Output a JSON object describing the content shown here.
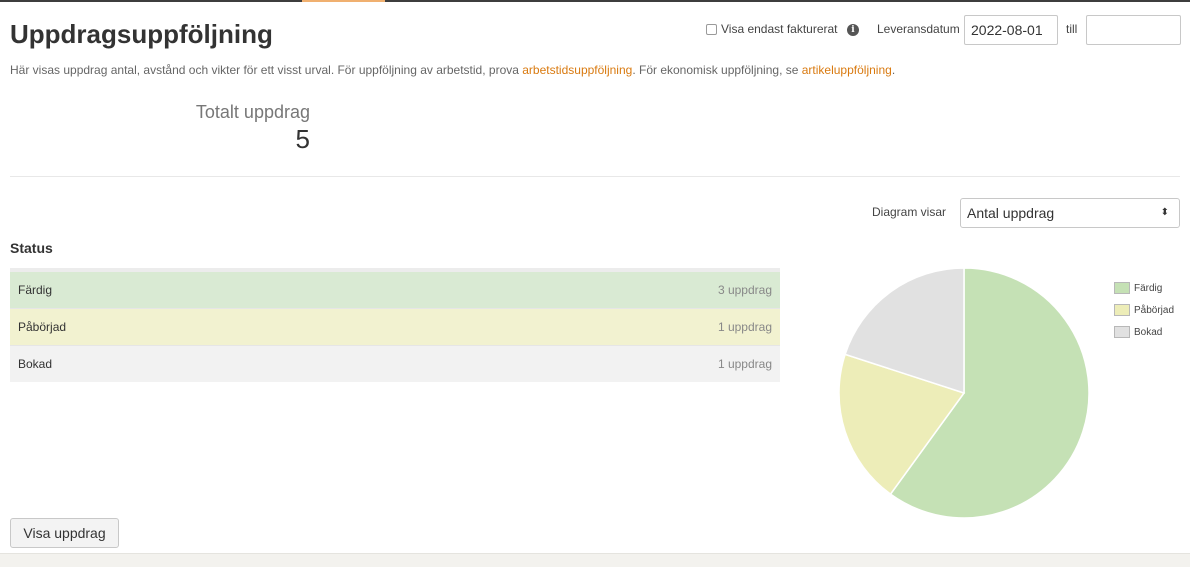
{
  "header": {
    "title": "Uppdragsuppföljning"
  },
  "filters": {
    "invoiced_only_label": "Visa endast fakturerat",
    "invoiced_only_checked": false,
    "info_icon": "info-icon",
    "delivery_date_label": "Leveransdatum",
    "date_from": "2022-08-01",
    "till_label": "till",
    "date_to": ""
  },
  "description": {
    "part1": "Här visas uppdrag antal, avstånd och vikter för ett visst urval. För uppföljning av arbetstid, prova ",
    "link1": "arbetstidsuppföljning",
    "part2": ". För ekonomisk uppföljning, se ",
    "link2": "artikeluppföljning",
    "part3": "."
  },
  "summary": {
    "total_label": "Totalt uppdrag",
    "total_value": "5"
  },
  "diagram": {
    "label": "Diagram visar",
    "selected": "Antal uppdrag"
  },
  "status": {
    "heading": "Status",
    "rows": [
      {
        "label": "Färdig",
        "count": "3 uppdrag"
      },
      {
        "label": "Påbörjad",
        "count": "1 uppdrag"
      },
      {
        "label": "Bokad",
        "count": "1 uppdrag"
      }
    ]
  },
  "chart_data": {
    "type": "pie",
    "categories": [
      "Färdig",
      "Påbörjad",
      "Bokad"
    ],
    "values": [
      3,
      1,
      1
    ],
    "colors": [
      "#c5e1b5",
      "#ededb8",
      "#e1e1e1"
    ],
    "legend_position": "right"
  },
  "actions": {
    "show_button": "Visa uppdrag"
  },
  "colors": {
    "accent": "#d97a10"
  }
}
